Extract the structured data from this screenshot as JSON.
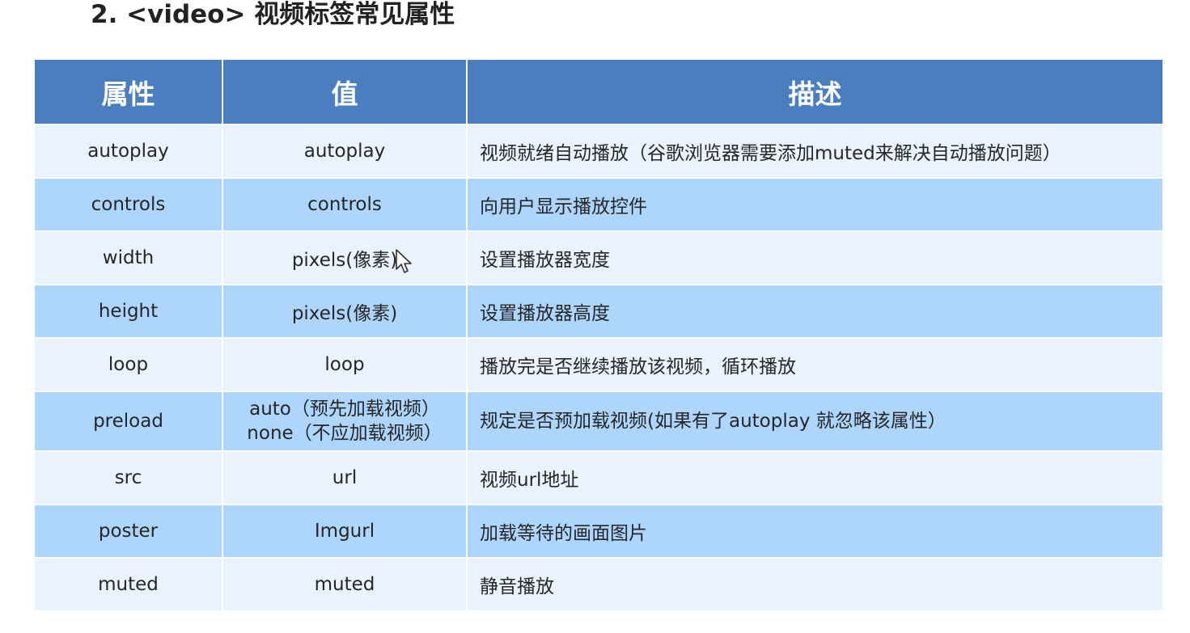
{
  "slide": {
    "title": "2. <video> 视频标签常见属性"
  },
  "table": {
    "headers": [
      "属性",
      "值",
      "描述"
    ],
    "rows": [
      {
        "attr": "autoplay",
        "values": [
          "autoplay"
        ],
        "desc": "视频就绪自动播放（谷歌浏览器需要添加muted来解决自动播放问题）"
      },
      {
        "attr": "controls",
        "values": [
          "controls"
        ],
        "desc": "向用户显示播放控件"
      },
      {
        "attr": "width",
        "values": [
          "pixels(像素)"
        ],
        "desc": "设置播放器宽度"
      },
      {
        "attr": "height",
        "values": [
          "pixels(像素)"
        ],
        "desc": "设置播放器高度"
      },
      {
        "attr": "loop",
        "values": [
          "loop"
        ],
        "desc": "播放完是否继续播放该视频，循环播放"
      },
      {
        "attr": "preload",
        "values": [
          "auto（预先加载视频）",
          "none（不应加载视频）"
        ],
        "desc": "规定是否预加载视频(如果有了autoplay 就忽略该属性）"
      },
      {
        "attr": "src",
        "values": [
          "url"
        ],
        "desc": "视频url地址"
      },
      {
        "attr": "poster",
        "values": [
          "Imgurl"
        ],
        "desc": "加载等待的画面图片"
      },
      {
        "attr": "muted",
        "values": [
          "muted"
        ],
        "desc": "静音播放"
      }
    ]
  },
  "colors": {
    "header_bg": "#4a7ebf",
    "row_light": "#eaf3fd",
    "row_dark": "#aed5fc"
  },
  "icons": {
    "cursor": "mouse-pointer-icon"
  }
}
